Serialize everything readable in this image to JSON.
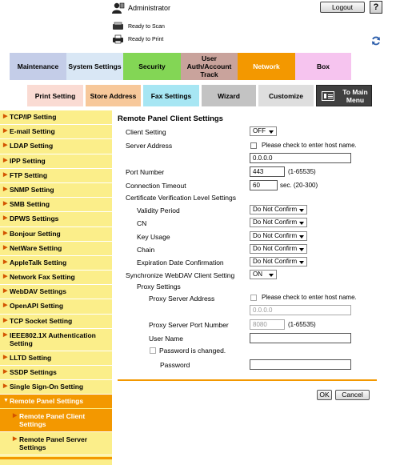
{
  "header": {
    "user_label": "Administrator",
    "logout_label": "Logout",
    "help_label": "?",
    "status_scan": "Ready to Scan",
    "status_print": "Ready to Print"
  },
  "tabs": {
    "row1": [
      "Maintenance",
      "System Settings",
      "Security",
      "User Auth/Account Track",
      "Network",
      "Box"
    ],
    "row2": [
      "Print Setting",
      "Store Address",
      "Fax Settings",
      "Wizard",
      "Customize",
      "To Main Menu"
    ],
    "active": "Network"
  },
  "sidebar": {
    "items": [
      "TCP/IP Setting",
      "E-mail Setting",
      "LDAP Setting",
      "IPP Setting",
      "FTP Setting",
      "SNMP Setting",
      "SMB Setting",
      "DPWS Settings",
      "Bonjour Setting",
      "NetWare Setting",
      "AppleTalk Setting",
      "Network Fax Setting",
      "WebDAV Settings",
      "OpenAPI Setting",
      "TCP Socket Setting",
      "IEEE802.1X Authentication Setting",
      "LLTD Setting",
      "SSDP Settings",
      "Single Sign-On Setting"
    ],
    "active_item": "Remote Panel Settings",
    "sub_items": [
      "Remote Panel Client Settings",
      "Remote Panel Server Settings"
    ]
  },
  "form": {
    "title": "Remote Panel Client Settings",
    "client_setting_label": "Client Setting",
    "client_setting_value": "OFF",
    "server_address_label": "Server Address",
    "host_name_check_label": "Please check to enter host name.",
    "server_address_value": "0.0.0.0",
    "port_label": "Port Number",
    "port_value": "443",
    "port_range": "(1-65535)",
    "timeout_label": "Connection Timeout",
    "timeout_value": "60",
    "timeout_range": "sec. (20-300)",
    "cert_label": "Certificate Verification Level Settings",
    "cert_items": [
      {
        "label": "Validity Period",
        "value": "Do Not Confirm"
      },
      {
        "label": "CN",
        "value": "Do Not Confirm"
      },
      {
        "label": "Key Usage",
        "value": "Do Not Confirm"
      },
      {
        "label": "Chain",
        "value": "Do Not Confirm"
      },
      {
        "label": "Expiration Date Confirmation",
        "value": "Do Not Confirm"
      }
    ],
    "sync_label": "Synchronize WebDAV Client Setting",
    "sync_value": "ON",
    "proxy_label": "Proxy Settings",
    "proxy_address_label": "Proxy Server Address",
    "proxy_host_check_label": "Please check to enter host name.",
    "proxy_address_value": "0.0.0.0",
    "proxy_port_label": "Proxy Server Port Number",
    "proxy_port_value": "8080",
    "proxy_port_range": "(1-65535)",
    "user_name_label": "User Name",
    "user_name_value": "",
    "password_changed_label": "Password is changed.",
    "password_label": "Password",
    "password_value": ""
  },
  "actions": {
    "ok_label": "OK",
    "cancel_label": "Cancel"
  },
  "colors": {
    "accent": "#f39800",
    "sidebar_bg": "#fbee8a",
    "tab_maintenance": "#c4cde8",
    "tab_system": "#d9e7f5",
    "tab_security": "#83d655",
    "tab_user_auth": "#c9a39c",
    "tab_network": "#f39800",
    "tab_box": "#f6c4ef"
  }
}
